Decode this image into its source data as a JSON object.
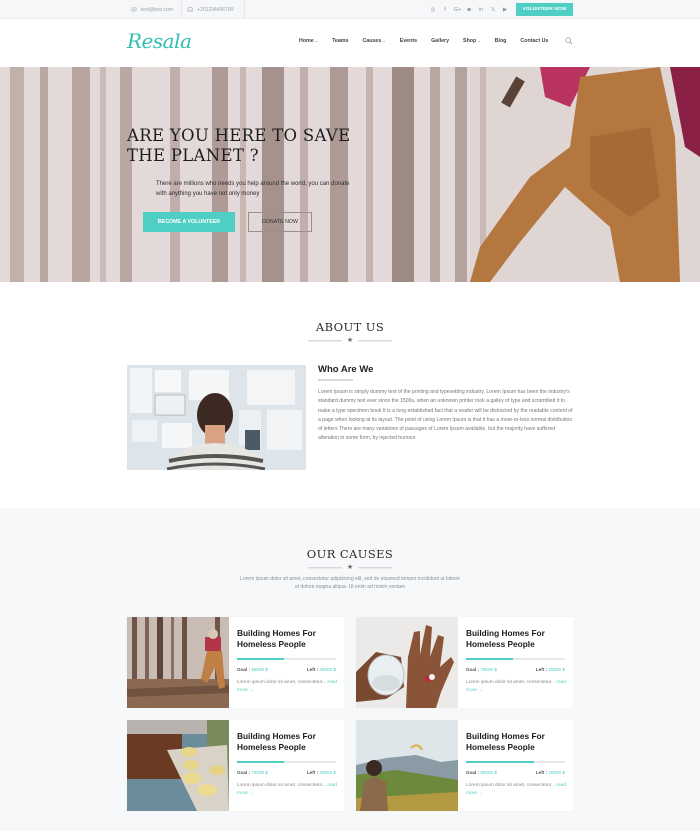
{
  "topbar": {
    "email": "test@test.com",
    "phone": "+201234456789",
    "socials": [
      "dribbble-icon",
      "facebook-icon",
      "google-plus-icon",
      "instagram-icon",
      "linkedin-icon",
      "twitter-icon",
      "youtube-icon"
    ],
    "socials_glyphs": [
      "◎",
      "f",
      "G+",
      "◙",
      "in",
      "𝕏",
      "▶"
    ],
    "volunteer_label": "VOLUNTEER NOW"
  },
  "header": {
    "logo": "Resala",
    "nav": [
      {
        "label": "Home",
        "dropdown": true
      },
      {
        "label": "Teams",
        "dropdown": false
      },
      {
        "label": "Causes",
        "dropdown": true
      },
      {
        "label": "Events",
        "dropdown": false
      },
      {
        "label": "Gallery",
        "dropdown": false
      },
      {
        "label": "Shop",
        "dropdown": true
      },
      {
        "label": "Blog",
        "dropdown": false
      },
      {
        "label": "Contact Us",
        "dropdown": false
      }
    ]
  },
  "hero": {
    "title_line1": "ARE YOU HERE TO SAVE",
    "title_line2": "THE PLANET ?",
    "subtitle": "There are millions who needs you help around the world, you can donate with anything you have not only money",
    "primary_button": "BECOME A VOLUNTEER",
    "secondary_button": "DONATE NOW"
  },
  "about": {
    "section_title": "ABOUT US",
    "heading": "Who Are We",
    "body": "Lorem Ipsum is simply dummy text of the printing and typesetting industry. Lorem Ipsum has been the industry's standard dummy text ever since the 1500s, when an unknown printer took a galley of type and scrambled it to make a type specimen book It is a long established fact that a reader will be distracted by the readable content of a page when looking at its layout. The point of using Lorem Ipsum is that it has a more-or-less normal distribution of letters There are many variations of passages of Lorem Ipsum available, but the majority have suffered alteration in some form, by injected humour"
  },
  "causes": {
    "section_title": "OUR CAUSES",
    "subtitle": "Lorem ipsum dolor sit amet, consectetur adipisicing elit, sed do eiusmod tempor incididunt ut labore et dolore magna aliqua. Ut enim ad minim veniam",
    "goal_label": "Goal :",
    "left_label": "Left :",
    "cards": [
      {
        "title": "Building Homes For Homeless People",
        "goal": "95000 $",
        "left": "45000 $",
        "progress": 0.47,
        "desc": "Lorem ipsum dolor sit amet, consectetur...",
        "read_more": "read more →",
        "image": "hiker-in-forest"
      },
      {
        "title": "Building Homes For Homeless People",
        "goal": "75000 $",
        "left": "35000 $",
        "progress": 0.47,
        "desc": "Lorem ipsum dolor sit amet, consectetur...",
        "read_more": "read more →",
        "image": "hand-with-pill-and-water"
      },
      {
        "title": "Building Homes For Homeless People",
        "goal": "75000 $",
        "left": "35000 $",
        "progress": 0.47,
        "desc": "Lorem ipsum dolor sit amet, consectetur...",
        "read_more": "read more →",
        "image": "pills-blister"
      },
      {
        "title": "Building Homes For Homeless People",
        "goal": "65000 $",
        "left": "45000 $",
        "progress": 0.69,
        "desc": "Lorem ipsum dolor sit amet, consectetur...",
        "read_more": "read more →",
        "image": "child-watching-paraglider"
      }
    ]
  },
  "colors": {
    "accent": "#4fcfc3",
    "logo": "#2fc0b4",
    "causes_bg": "#f7f8fa"
  }
}
